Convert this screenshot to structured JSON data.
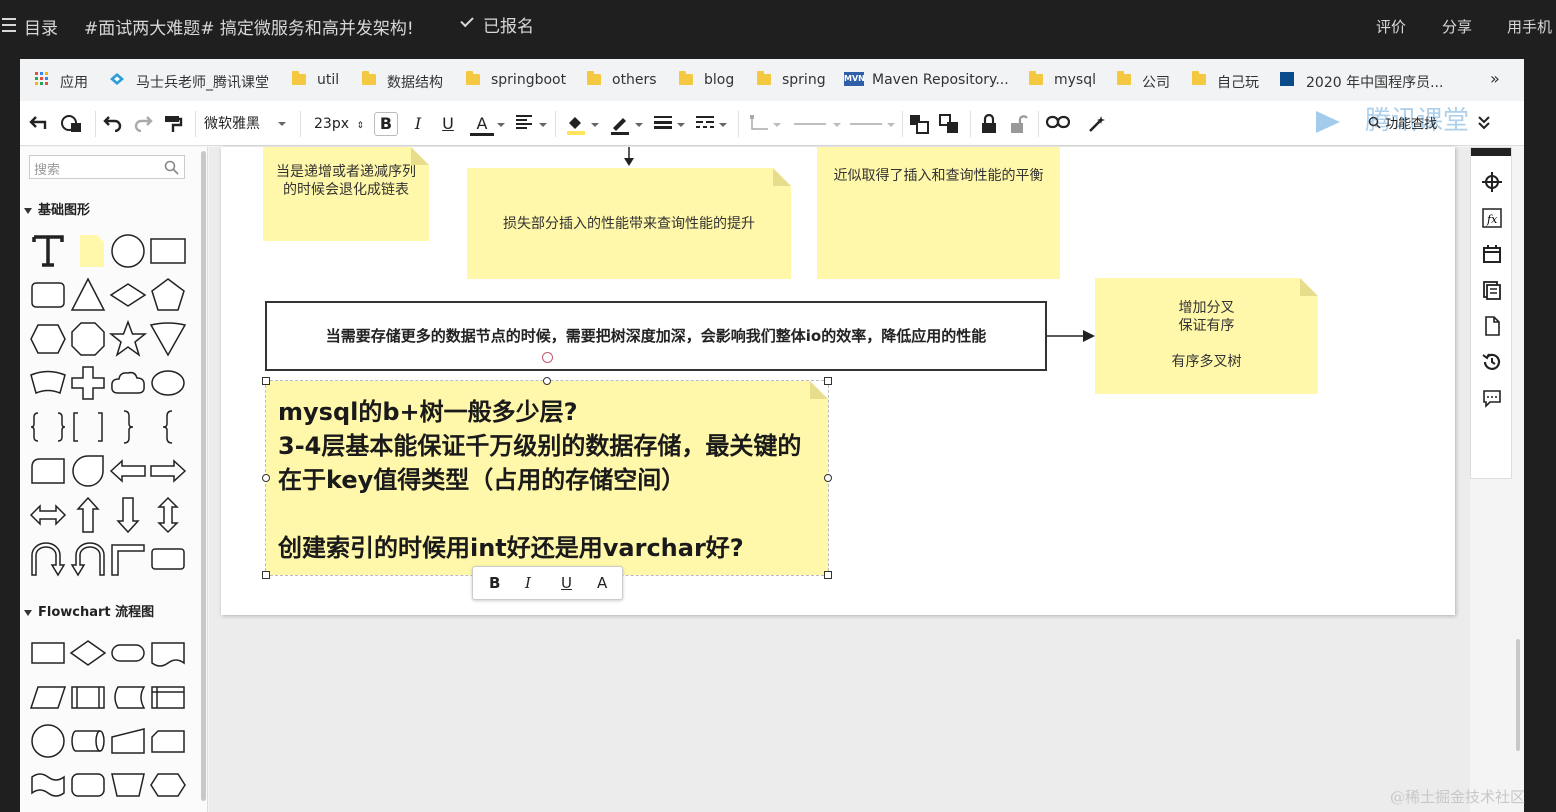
{
  "topbar": {
    "catalog": "目录",
    "course_title": "#面试两大难题# 搞定微服务和高并发架构!",
    "enrolled": "已报名",
    "rate": "评价",
    "share": "分享",
    "mobile": "用手机"
  },
  "bookmarks": {
    "apps": "应用",
    "items": [
      "马士兵老师_腾讯课堂",
      "util",
      "数据结构",
      "springboot",
      "others",
      "blog",
      "spring",
      "Maven Repository...",
      "mysql",
      "公司",
      "自己玩",
      "2020 年中国程序员..."
    ],
    "more": "»",
    "maven_badge": "MVN"
  },
  "toolbar": {
    "font_family": "微软雅黑",
    "font_size": "23px",
    "bold": "B",
    "italic": "I",
    "underline": "U",
    "font_color": "A",
    "feature_search": "功能查找",
    "watermark": "腾讯课堂"
  },
  "sidebar": {
    "search_placeholder": "搜索",
    "basic_shapes": "基础图形",
    "flowchart": "Flowchart 流程图"
  },
  "diagram": {
    "note1": "当是递增或者递减序列的时候会退化成链表",
    "note2": "损失部分插入的性能带来查询性能的提升",
    "note3": "近似取得了插入和查询性能的平衡",
    "note4_line1": "增加分叉",
    "note4_line2": "保证有序",
    "note4_line3": "有序多叉树",
    "main_rect": "当需要存储更多的数据节点的时候，需要把树深度加深，会影响我们整体io的效率，降低应用的性能",
    "selected_line1": "mysql的b+树一般多少层?",
    "selected_line2": "3-4层基本能保证千万级别的数据存储，最关键的在于key值得类型（占用的存储空间）",
    "selected_line3": "创建索引的时候用int好还是用varchar好?"
  },
  "text_toolbar": {
    "bold": "B",
    "italic": "I",
    "underline": "U",
    "color": "A"
  },
  "site_watermark": "@稀土掘金技术社区",
  "colors": {
    "note_yellow": "#fff7a9",
    "topbar": "#1f1f1f"
  }
}
